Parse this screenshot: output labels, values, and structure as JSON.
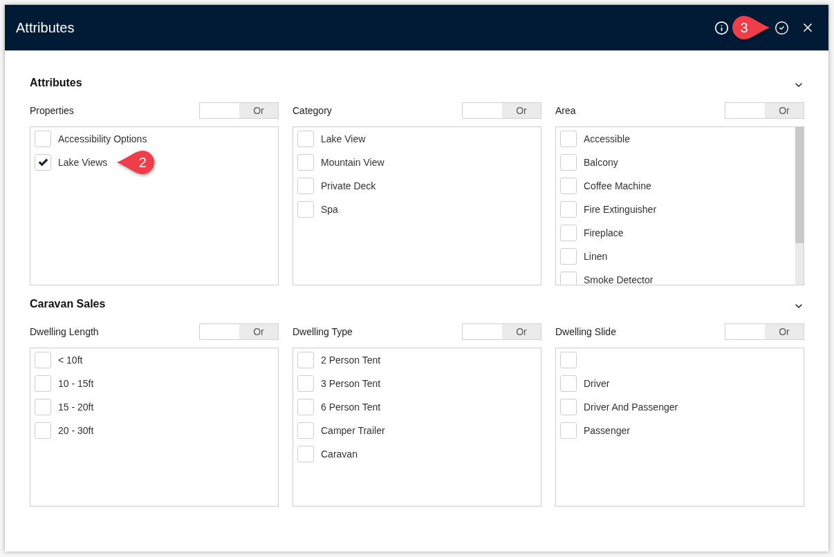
{
  "header": {
    "title": "Attributes",
    "callout": "3"
  },
  "sections": [
    {
      "title": "Attributes",
      "expanded": true,
      "groups": [
        {
          "label": "Properties",
          "toggle": {
            "label": "Or",
            "on": true
          },
          "items": [
            {
              "label": "Accessibility Options",
              "checked": false
            },
            {
              "label": "Lake Views",
              "checked": true,
              "callout": "2"
            }
          ]
        },
        {
          "label": "Category",
          "toggle": {
            "label": "Or",
            "on": true
          },
          "items": [
            {
              "label": "Lake View",
              "checked": false
            },
            {
              "label": "Mountain View",
              "checked": false
            },
            {
              "label": "Private Deck",
              "checked": false
            },
            {
              "label": "Spa",
              "checked": false
            }
          ]
        },
        {
          "label": "Area",
          "toggle": {
            "label": "Or",
            "on": true
          },
          "items": [
            {
              "label": "Accessible",
              "checked": false
            },
            {
              "label": "Balcony",
              "checked": false
            },
            {
              "label": "Coffee Machine",
              "checked": false
            },
            {
              "label": "Fire Extinguisher",
              "checked": false
            },
            {
              "label": "Fireplace",
              "checked": false
            },
            {
              "label": "Linen",
              "checked": false
            },
            {
              "label": "Smoke Detector",
              "checked": false
            }
          ]
        }
      ]
    },
    {
      "title": "Caravan Sales",
      "expanded": true,
      "groups": [
        {
          "label": "Dwelling Length",
          "toggle": {
            "label": "Or",
            "on": true
          },
          "items": [
            {
              "label": "< 10ft",
              "checked": false
            },
            {
              "label": "10 - 15ft",
              "checked": false
            },
            {
              "label": "15 - 20ft",
              "checked": false
            },
            {
              "label": "20 - 30ft",
              "checked": false
            }
          ]
        },
        {
          "label": "Dwelling Type",
          "toggle": {
            "label": "Or",
            "on": true
          },
          "items": [
            {
              "label": "2 Person Tent",
              "checked": false
            },
            {
              "label": "3 Person Tent",
              "checked": false
            },
            {
              "label": "6 Person Tent",
              "checked": false
            },
            {
              "label": "Camper Trailer",
              "checked": false
            },
            {
              "label": "Caravan",
              "checked": false
            }
          ]
        },
        {
          "label": "Dwelling Slide",
          "toggle": {
            "label": "Or",
            "on": true
          },
          "items": [
            {
              "checked": false
            },
            {
              "label": "Driver",
              "checked": false
            },
            {
              "label": "Driver And Passenger",
              "checked": false
            },
            {
              "label": "Passenger",
              "checked": false
            }
          ]
        }
      ]
    }
  ]
}
